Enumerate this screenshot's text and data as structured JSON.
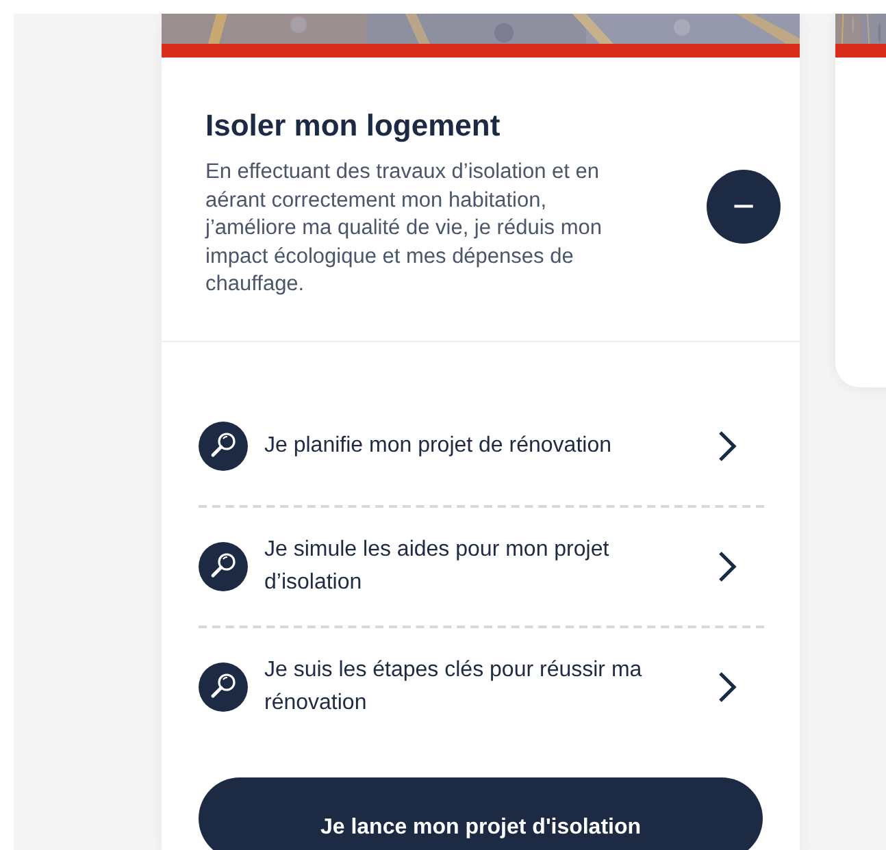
{
  "card": {
    "title": "Isoler mon logement",
    "description": "En effectuant des travaux d’isolation et en aérant correctement mon habitation, j’améliore ma qualité de vie, je réduis mon impact écologique et mes dépenses de chauffage.",
    "toggle": {
      "label": "−",
      "expanded": true
    },
    "steps": [
      {
        "label": "Je planifie mon projet de rénovation"
      },
      {
        "label": "Je simule les aides pour mon projet d’isolation"
      },
      {
        "label": "Je suis les étapes clés pour réussir ma rénovation"
      }
    ],
    "cta": "Je lance mon projet d'isolation"
  }
}
